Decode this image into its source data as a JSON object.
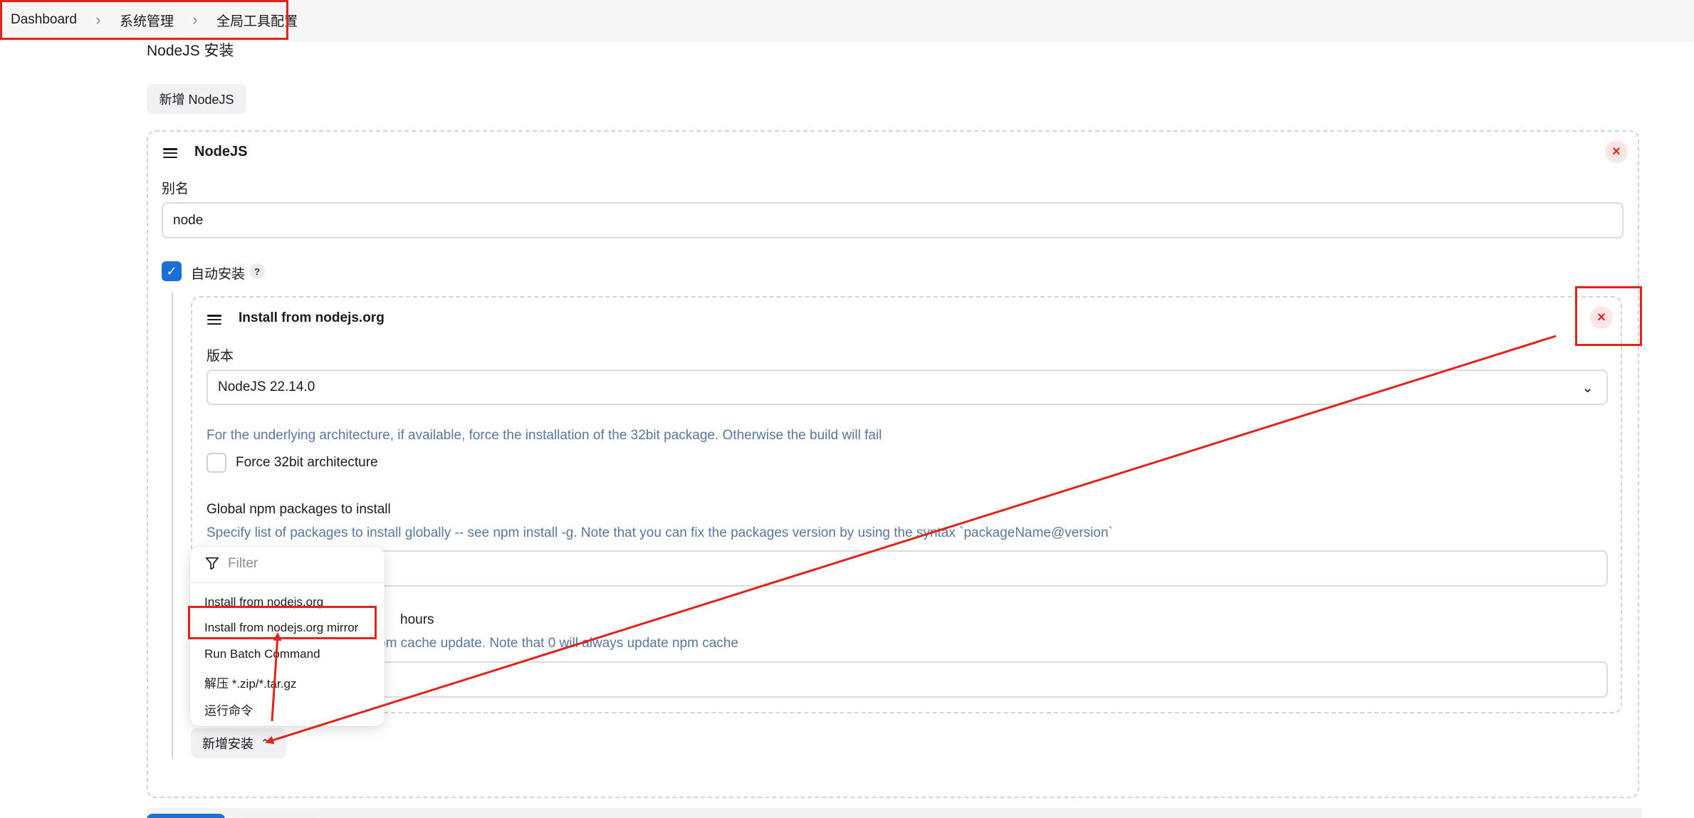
{
  "breadcrumb": {
    "items": [
      "Dashboard",
      "系统管理",
      "全局工具配置"
    ],
    "separator": ">"
  },
  "section_title": "NodeJS 安装",
  "add_nodejs_button": "新增 NodeJS",
  "nodejs_block": {
    "title": "NodeJS",
    "close_symbol": "×",
    "alias_label": "别名",
    "alias_value": "node",
    "auto_install_label": "自动安装",
    "auto_install_checked": true,
    "help_symbol": "?"
  },
  "installer_block": {
    "title": "Install from nodejs.org",
    "close_symbol": "×",
    "version_label": "版本",
    "version_value": "NodeJS 22.14.0",
    "force32_help": "For the underlying architecture, if available, force the installation of the 32bit package. Otherwise the build will fail",
    "force32_label": "Force 32bit architecture",
    "force32_checked": false,
    "npm_packages_label": "Global npm packages to install",
    "npm_packages_help": "Specify list of packages to install globally -- see npm install -g. Note that you can fix the packages version by using the syntax `packageName@version`",
    "npm_refresh_label_visible": "hours",
    "npm_refresh_help_visible": "om cache update. Note that 0 will always update npm cache"
  },
  "dropdown_menu": {
    "filter_placeholder": "Filter",
    "items": [
      "Install from nodejs.org",
      "Install from nodejs.org mirror",
      "Run Batch Command",
      "解压 *.zip/*.tar.gz",
      "运行命令"
    ],
    "highlighted_item": "Install from nodejs.org mirror"
  },
  "add_installer_button": "新增安装",
  "colors": {
    "annotation_red": "#e0241c",
    "accent_blue": "#1a6fd9",
    "help_text": "#58789b"
  }
}
